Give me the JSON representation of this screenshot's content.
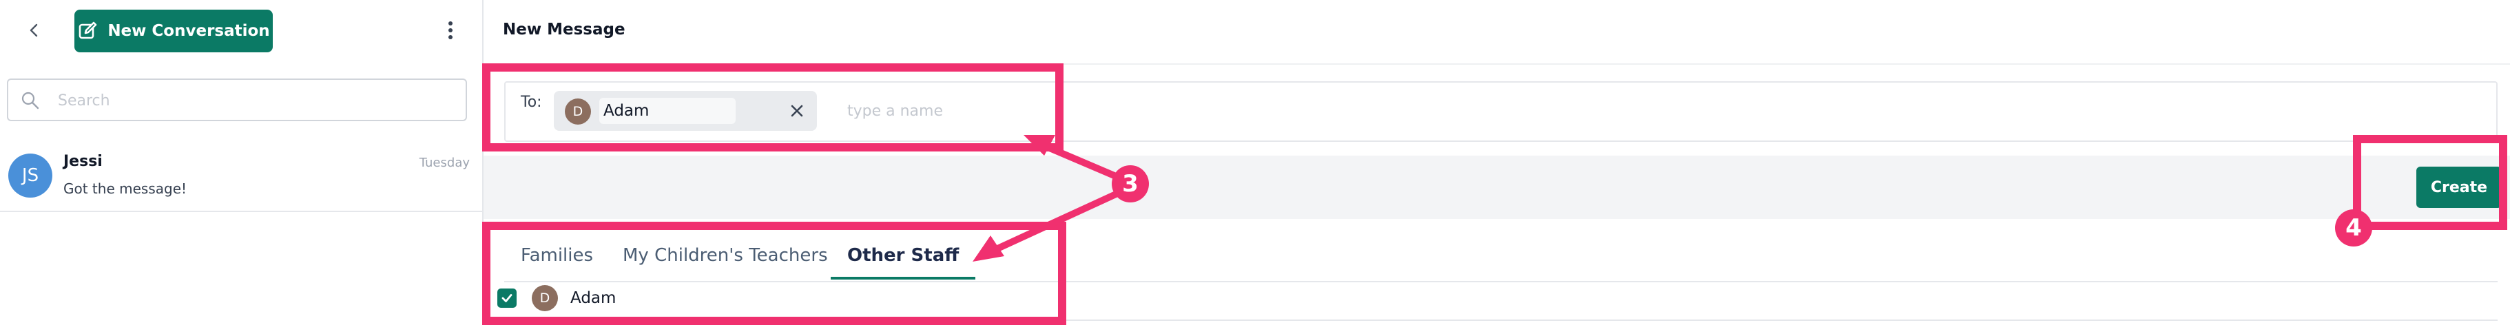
{
  "sidebar": {
    "new_conversation_label": "New Conversation",
    "search_placeholder": "Search",
    "conversations": [
      {
        "initials": "JS",
        "name": "Jessi",
        "date": "Tuesday",
        "preview": "Got the message!"
      }
    ]
  },
  "main": {
    "title": "New Message",
    "to_label": "To:",
    "recipient": {
      "initial": "D",
      "name": "Adam"
    },
    "to_placeholder": "type a name",
    "create_label": "Create",
    "tabs": [
      {
        "label": "Families"
      },
      {
        "label": "My Children's Teachers"
      },
      {
        "label": "Other Staff",
        "active": true
      }
    ],
    "staff": [
      {
        "initial": "D",
        "name": "Adam",
        "checked": true
      }
    ]
  },
  "annotations": {
    "step3": "3",
    "step4": "4",
    "color": "#f0306f"
  },
  "colors": {
    "accent": "#0b7a65",
    "avatar_blue": "#4a90d9",
    "avatar_brown": "#8c6e5f"
  }
}
